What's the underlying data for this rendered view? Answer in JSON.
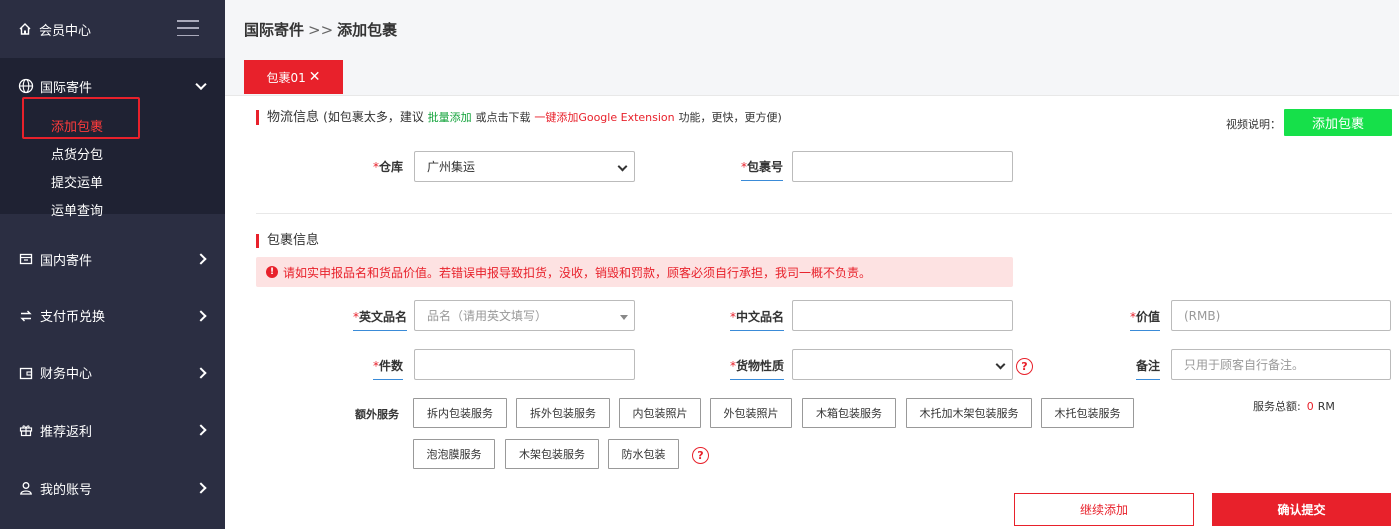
{
  "sidebar": {
    "header": {
      "title": "会员中心",
      "icon": "home-icon"
    },
    "items": [
      {
        "label": "国际寄件",
        "icon": "globe-icon",
        "expanded": true,
        "children": [
          {
            "label": "添加包裹",
            "active": true
          },
          {
            "label": "点货分包"
          },
          {
            "label": "提交运单"
          },
          {
            "label": "运单查询"
          }
        ]
      },
      {
        "label": "国内寄件",
        "icon": "box-icon"
      },
      {
        "label": "支付币兑换",
        "icon": "exchange-icon"
      },
      {
        "label": "财务中心",
        "icon": "wallet-icon"
      },
      {
        "label": "推荐返利",
        "icon": "gift-icon"
      },
      {
        "label": "我的账号",
        "icon": "user-icon"
      }
    ]
  },
  "breadcrumb": {
    "parent": "国际寄件",
    "sep": ">>",
    "current": "添加包裹"
  },
  "tabs": [
    {
      "label": "包裹01",
      "close": "✕"
    }
  ],
  "logistics": {
    "title": "物流信息",
    "note_pre": "(如包裹太多，建议",
    "bulk_link": "批量添加",
    "note_mid": "或点击下载",
    "ext_link": "一键添加Google Extension",
    "note_post": "功能，更快，更方便)",
    "video_label": "视频说明：",
    "add_button": "添加包裹",
    "warehouse_label": "仓库",
    "warehouse_value": "广州集运",
    "package_no_label": "包裹号",
    "package_no_value": ""
  },
  "package": {
    "title": "包裹信息",
    "warning": "请如实申报品名和货品价值。若错误申报导致扣货，没收，销毁和罚款，顾客必须自行承担，我司一概不负责。",
    "en_name_label": "英文品名",
    "en_name_placeholder": "品名（请用英文填写）",
    "cn_name_label": "中文品名",
    "value_label": "价值",
    "value_placeholder": "(RMB)",
    "qty_label": "件数",
    "goods_type_label": "货物性质",
    "remark_label": "备注",
    "remark_placeholder": "只用于顾客自行备注。",
    "extra_label": "额外服务",
    "services": [
      "拆内包装服务",
      "拆外包装服务",
      "内包装照片",
      "外包装照片",
      "木箱包装服务",
      "木托加木架包装服务",
      "木托包装服务",
      "泡泡膜服务",
      "木架包装服务",
      "防水包装"
    ],
    "total_label": "服务总额:",
    "total_value": "0",
    "total_unit": "RM"
  },
  "actions": {
    "continue": "继续添加",
    "submit": "确认提交"
  },
  "colors": {
    "accent": "#e8212b",
    "sidebar": "#2b2e42",
    "green": "#16e04a"
  }
}
